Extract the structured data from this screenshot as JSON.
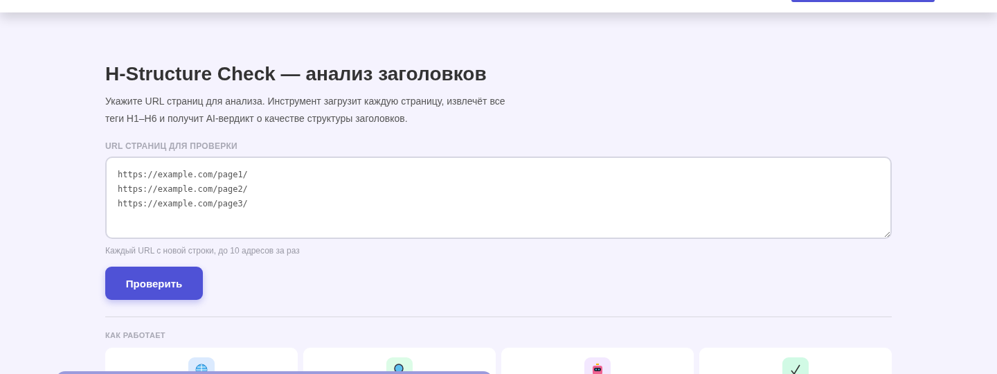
{
  "title": "H-Structure Check — анализ заголовков",
  "description": "Укажите URL страниц для анализа. Инструмент загрузит каждую страницу, извлечёт все теги H1–H6 и получит AI-вердикт о качестве структуры заголовков.",
  "url_field": {
    "label": "URL СТРАНИЦ ДЛЯ ПРОВЕРКИ",
    "placeholder": "https://example.com/page1/\nhttps://example.com/page2/\nhttps://example.com/page3/",
    "hint": "Каждый URL с новой строки, до 10 адресов за раз"
  },
  "submit_button": "Проверить",
  "how_it_works": {
    "heading": "КАК РАБОТАЕТ",
    "steps": [
      {
        "kind": "globe"
      },
      {
        "kind": "search"
      },
      {
        "kind": "robot"
      },
      {
        "kind": "check"
      }
    ]
  }
}
